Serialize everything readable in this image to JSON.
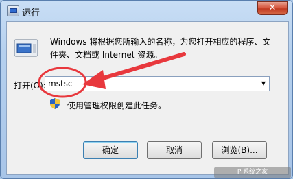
{
  "window": {
    "title": "运行",
    "close_label": "✕"
  },
  "dialog": {
    "description": "Windows 将根据您所输入的名称，为您打开相应的程序、文件夹、文档或 Internet 资源。",
    "open_label": "打开(O):",
    "command_value": "mstsc",
    "admin_note": "使用管理权限创建此任务。"
  },
  "buttons": {
    "ok": "确定",
    "cancel": "取消",
    "browse": "浏览(B)..."
  },
  "icons": {
    "run_icon": "run-program-icon",
    "shield_icon": "uac-shield-icon",
    "dropdown_icon": "chevron-down-icon",
    "close_icon": "close-icon"
  },
  "colors": {
    "annotation": "#e8383d",
    "close_button": "#c94a32",
    "title_bar": "#b5d0ee"
  },
  "watermark": "P 系统之家"
}
